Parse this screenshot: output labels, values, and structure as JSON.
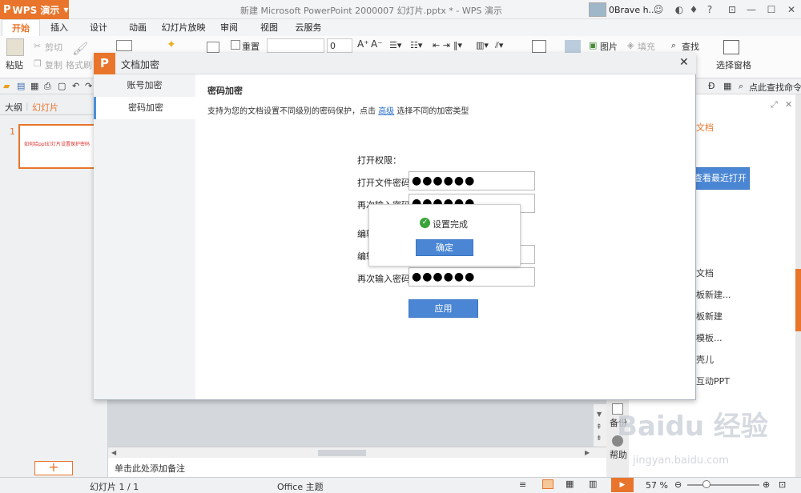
{
  "app": {
    "name": "WPS 演示",
    "logo": "P"
  },
  "window": {
    "title": "新建 Microsoft PowerPoint 2000007 幻灯片.pptx * - WPS 演示",
    "user": "0Brave h..."
  },
  "tabs": [
    "开始",
    "插入",
    "设计",
    "动画",
    "幻灯片放映",
    "审阅",
    "视图",
    "云服务"
  ],
  "ribbon": {
    "paste": "粘贴",
    "cut": "剪切",
    "copy": "复制",
    "format_painter": "格式刷",
    "reset": "重置",
    "font_size": "0",
    "picture": "图片",
    "fill": "填充",
    "find": "查找",
    "selection_pane": "选择窗格",
    "accent": "#e8752b"
  },
  "quick_access": {
    "find_command": "点此查找命令"
  },
  "left_pane": {
    "tab_outline": "大纲",
    "tab_slides": "幻灯片",
    "slide_number": "1",
    "thumb_text": "如何给ppt幻灯片设置保护密码"
  },
  "notes": {
    "placeholder": "单击此处添加备注"
  },
  "right_panel": {
    "title_partial": "文档",
    "recent_button": "查看最近打开",
    "items": [
      "文档",
      "板新建...",
      "板新建",
      "模板...",
      "壳儿",
      "互动PPT"
    ],
    "backup": "备份",
    "help": "帮助"
  },
  "status": {
    "slide_pos": "幻灯片 1 / 1",
    "theme": "Office 主题",
    "zoom": "57 %",
    "zoom_level": 0.57
  },
  "dialog": {
    "title": "文档加密",
    "nav": [
      "账号加密",
      "密码加密"
    ],
    "section_title": "密码加密",
    "description_before": "支持为您的文档设置不同级别的密码保护，点击",
    "description_link": "高级",
    "description_after": "选择不同的加密类型",
    "open_permission": "打开权限：",
    "open_password_label": "打开文件密码:",
    "open_password_value": "●●●●●●",
    "confirm_label": "再次输入密码:",
    "confirm_value": "●●●●●●",
    "edit_label_1": "编辑",
    "edit_label_2": "编辑",
    "edit_confirm_label": "再次输入密码:",
    "edit_confirm_value": "●●●●●●",
    "apply": "应用",
    "popup": {
      "message": "设置完成",
      "ok": "确定"
    }
  },
  "watermark": {
    "text": "Baidu 经验",
    "url": "jingyan.baidu.com"
  },
  "colors": {
    "link": "#2a6fc9",
    "button_blue": "#4a86d4",
    "success_green": "#3aa33a"
  }
}
